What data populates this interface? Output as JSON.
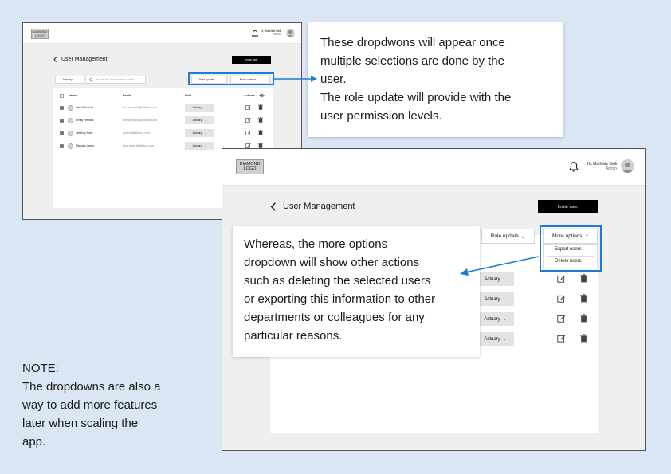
{
  "app": {
    "logo": [
      "DIAMOND",
      "LOGO"
    ],
    "greeting": "Hi, Mathilde Belli",
    "role_label": "Admin",
    "page_title": "User Management",
    "invite_label": "Invite user",
    "filter_label": "Actuary",
    "search_placeholder": "Search the user name or email",
    "role_update_label": "Role update",
    "more_options_label": "More options"
  },
  "table": {
    "headers": {
      "name": "Name",
      "email": "Email",
      "role": "Role",
      "actions": "Actions"
    },
    "rows": [
      {
        "name": "Leo Eduardo",
        "email": "leo.eduardo@allianz.com",
        "role": "Actuary",
        "checked": true
      },
      {
        "name": "Emily Renold",
        "email": "emily.renold@allianz.com",
        "role": "Actuary",
        "checked": true
      },
      {
        "name": "Jeremy Neal",
        "email": "jeremy@allianz.com",
        "role": "Actuary",
        "checked": true
      },
      {
        "name": "Nicolas Lauer",
        "email": "nico.lauer@allianz.com",
        "role": "Actuary",
        "checked": true
      }
    ]
  },
  "more_options_menu": {
    "items": [
      "Export users",
      "Delete users"
    ]
  },
  "annotations": {
    "dropdowns_note": [
      "These dropdwons will appear once",
      "multiple selections are done by the",
      "user.",
      "The role update will provide with the",
      "user permission levels."
    ],
    "more_options_note": [
      "Whereas, the more options",
      "dropdown will show other actions",
      "such as deleting the selected users",
      "or exporting this information to other",
      "departments or colleagues for any",
      "particular reasons."
    ],
    "footer_note": [
      "NOTE:",
      "The dropdowns are also a",
      "way to add more features",
      "later when scaling the",
      "app."
    ]
  },
  "colors": {
    "highlight": "#1d7bd6",
    "background": "#dbe6f5",
    "primary_button": "#000000"
  },
  "icons": [
    "bell-icon",
    "avatar-icon",
    "back-arrow-icon",
    "search-icon",
    "chevron-down-icon",
    "chevron-up-icon",
    "edit-icon",
    "trash-icon",
    "eye-icon"
  ]
}
